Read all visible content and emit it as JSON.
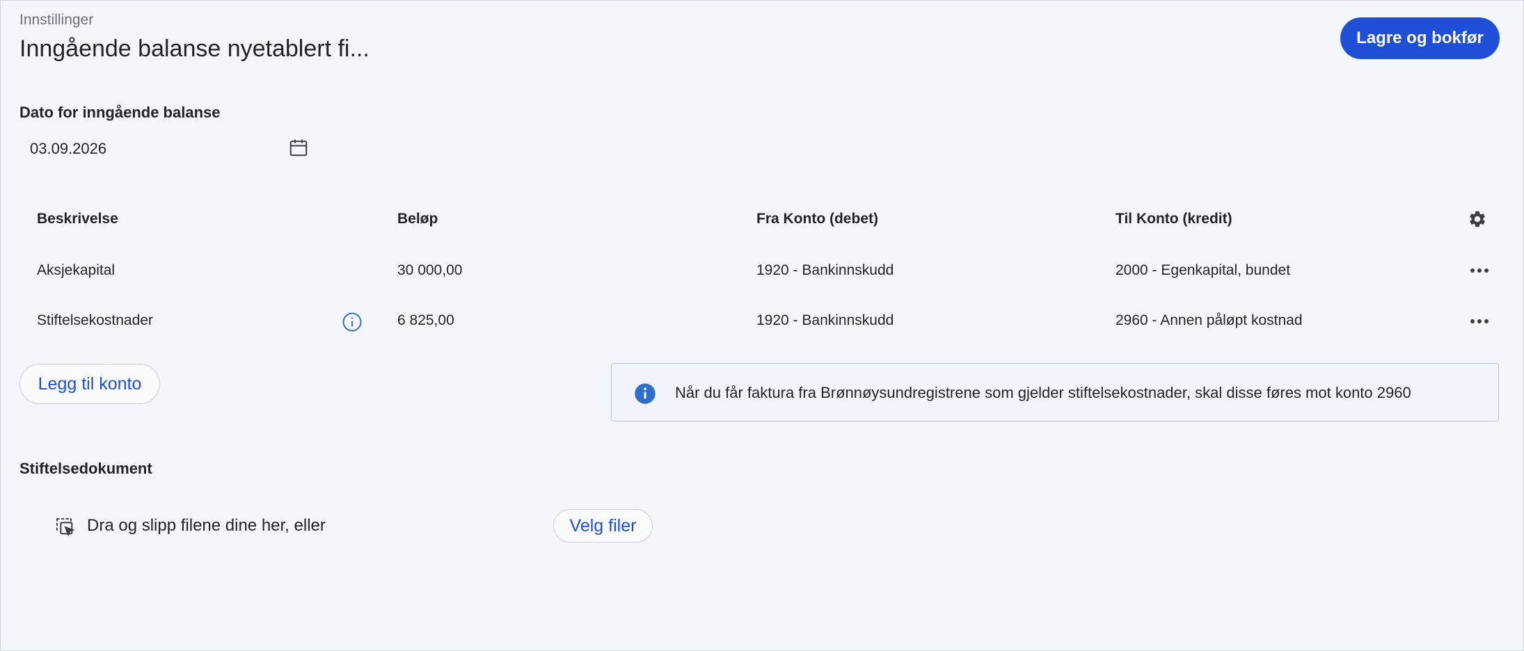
{
  "header": {
    "breadcrumb": "Innstillinger",
    "title": "Inngående balanse nyetablert fi...",
    "save_label": "Lagre og bokfør"
  },
  "date": {
    "label": "Dato for inngående balanse",
    "value": "03.09.2026"
  },
  "table": {
    "headers": [
      "Beskrivelse",
      "Beløp",
      "Fra Konto (debet)",
      "Til Konto (kredit)"
    ],
    "rows": [
      {
        "description": "Aksjekapital",
        "amount": "30 000,00",
        "from": "1920 - Bankinnskudd",
        "to": "2000 - Egenkapital, bundet"
      },
      {
        "description": "Stiftelsekostnader",
        "amount": "6 825,00",
        "from": "1920 - Bankinnskudd",
        "to": "2960 - Annen påløpt kostnad"
      }
    ]
  },
  "actions": {
    "add_account_label": "Legg til konto"
  },
  "info": {
    "text": "Når du får faktura fra Brønnøysundregistrene som gjelder stiftelsekostnader, skal disse føres mot konto 2960"
  },
  "documents": {
    "label": "Stiftelsedokument",
    "drop_text": "Dra og slipp filene dine her, eller",
    "choose_label": "Velg filer"
  },
  "colors": {
    "primary": "#1f4fd6",
    "background": "#f3f6fa",
    "info_icon": "#2f6fcb"
  },
  "icons": [
    "calendar-icon",
    "gear-icon",
    "more-icon",
    "info-icon",
    "drag-drop-icon"
  ]
}
